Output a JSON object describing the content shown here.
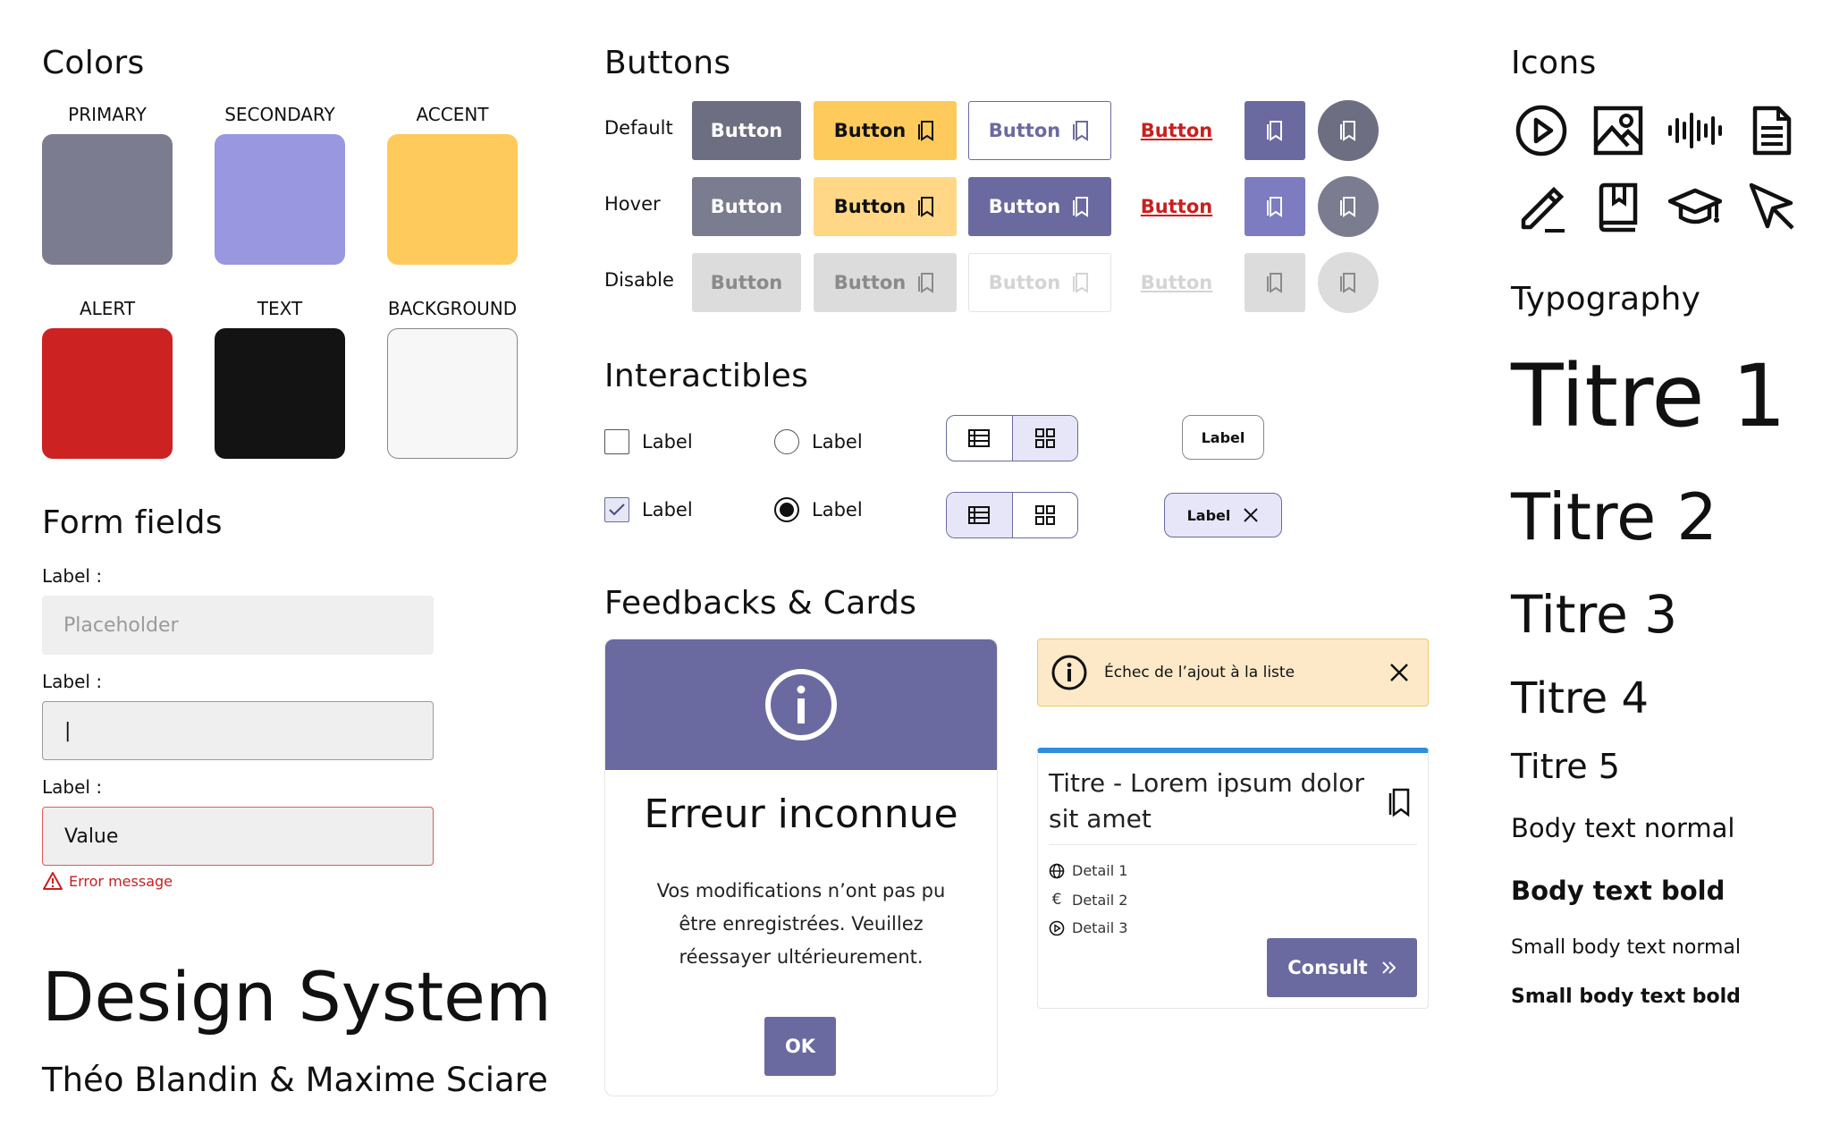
{
  "colors": {
    "title": "Colors",
    "swatches": [
      {
        "label": "PRIMARY",
        "hex": "#7b7c8f"
      },
      {
        "label": "SECONDARY",
        "hex": "#9897e0"
      },
      {
        "label": "ACCENT",
        "hex": "#ffca5c"
      },
      {
        "label": "ALERT",
        "hex": "#cc2222"
      },
      {
        "label": "TEXT",
        "hex": "#131313"
      },
      {
        "label": "BACKGROUND",
        "hex": "#f7f7f7"
      }
    ]
  },
  "form": {
    "title": "Form fields",
    "fields": [
      {
        "label": "Label :",
        "value": "Placeholder",
        "state": "placeholder"
      },
      {
        "label": "Label :",
        "value": "|",
        "state": "focused"
      },
      {
        "label": "Label :",
        "value": "Value",
        "state": "error"
      }
    ],
    "error_message": "Error message"
  },
  "footer": {
    "title": "Design System",
    "authors": "Théo Blandin & Maxime Sciare"
  },
  "buttons": {
    "title": "Buttons",
    "rows": [
      "Default",
      "Hover",
      "Disable"
    ],
    "label": "Button"
  },
  "interactibles": {
    "title": "Interactibles",
    "checkbox_label": "Label",
    "radio_label": "Label",
    "chip_label": "Label"
  },
  "feedback": {
    "title": "Feedbacks & Cards",
    "modal": {
      "title": "Erreur inconnue",
      "text": "Vos modifications n’ont pas pu être enregistrées. Veuillez réessayer ultérieurement.",
      "ok_label": "OK"
    },
    "toast": {
      "message": "Échec de l’ajout à la liste"
    },
    "card": {
      "title": "Titre - Lorem ipsum dolor sit amet",
      "details": [
        "Detail 1",
        "Detail 2",
        "Detail 3"
      ],
      "button_label": "Consult"
    }
  },
  "icons": {
    "title": "Icons",
    "items": [
      "play-circle-icon",
      "image-icon",
      "audio-wave-icon",
      "document-icon",
      "pencil-icon",
      "book-icon",
      "graduation-cap-icon",
      "cursor-icon"
    ]
  },
  "typography": {
    "title": "Typography",
    "samples": {
      "h1": "Titre 1",
      "h2": "Titre 2",
      "h3": "Titre 3",
      "h4": "Titre 4",
      "h5": "Titre 5",
      "body": "Body text normal",
      "body_bold": "Body text bold",
      "small": "Small body text normal",
      "small_bold": "Small body text bold"
    }
  },
  "palette": {
    "primary": "#6a6aa0",
    "primary_hover": "#7d7cc0",
    "gray_btn": "#6e6e82",
    "gray_btn_hover": "#7c7c90",
    "disabled_bg": "#dcdcdc",
    "disabled_text": "#8a8a8a",
    "accent": "#ffca5c",
    "accent_hover": "#ffd787",
    "alert": "#c8201f"
  }
}
